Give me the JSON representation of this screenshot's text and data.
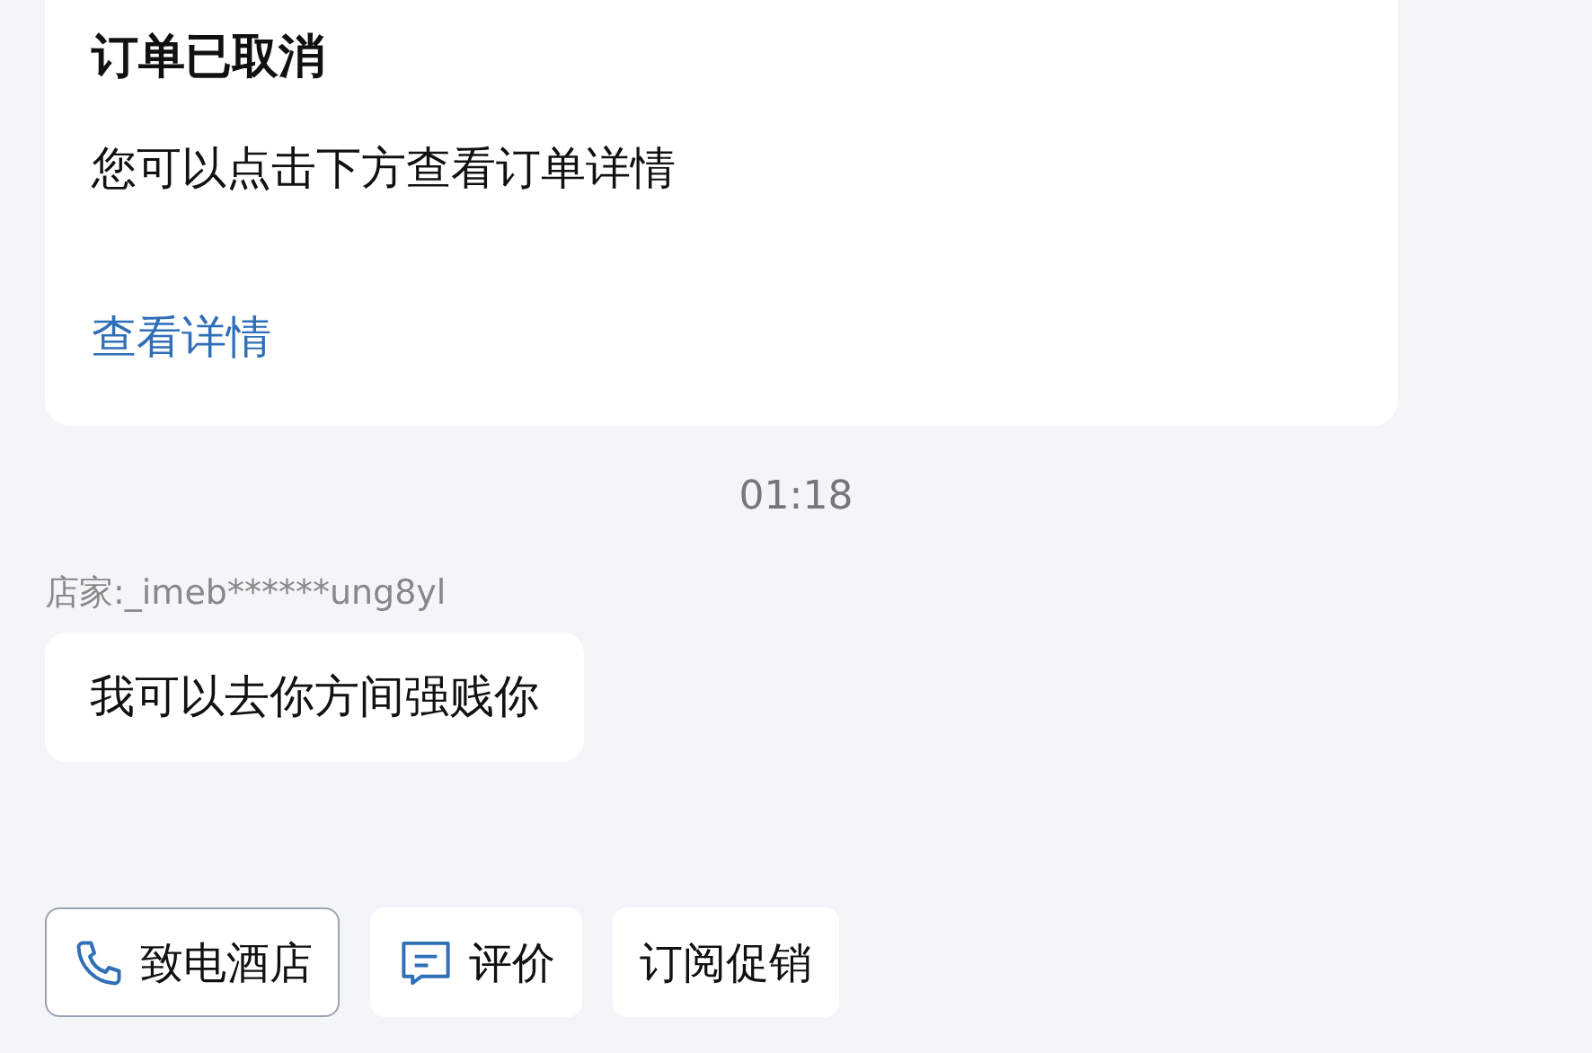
{
  "order_card": {
    "title": "订单已取消",
    "message": "您可以点击下方查看订单详情",
    "link": "查看详情"
  },
  "timestamp": "01:18",
  "messages": [
    {
      "sender": "店家:_imeb******ung8yl",
      "text": "我可以去你方间强贱你"
    }
  ],
  "actions": [
    {
      "kind": "call",
      "label": "致电酒店",
      "outlined": true
    },
    {
      "kind": "review",
      "label": "评价",
      "outlined": false
    },
    {
      "kind": "plain",
      "label": "订阅促销",
      "outlined": false
    }
  ]
}
